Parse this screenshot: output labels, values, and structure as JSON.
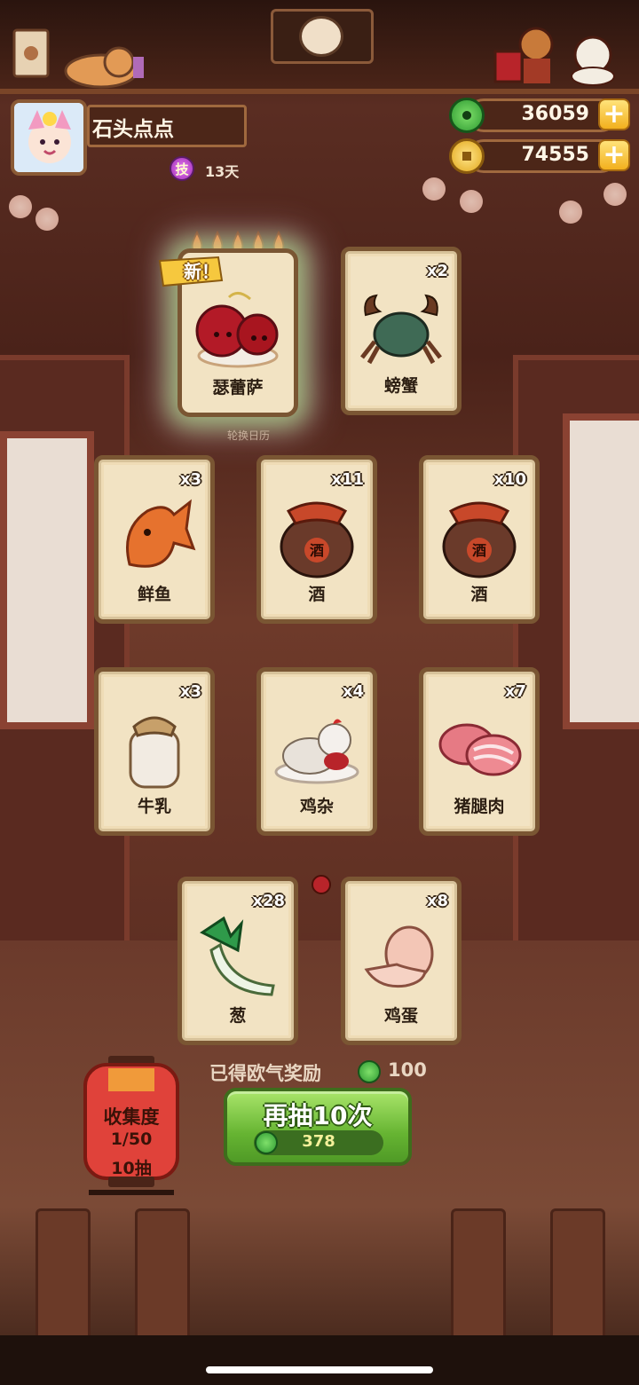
{
  "player": {
    "name": "石头点点",
    "skill_badge": "技",
    "skill_days": "13天"
  },
  "currency": {
    "jade": "36059",
    "coins": "74555"
  },
  "card_header": {
    "new_tag": "新！",
    "watermark": "轮换日历"
  },
  "cards": [
    {
      "name": "瑟蕾萨",
      "count": ""
    },
    {
      "name": "螃蟹",
      "count": "x2"
    },
    {
      "name": "鲜鱼",
      "count": "x3"
    },
    {
      "name": "酒",
      "count": "x11"
    },
    {
      "name": "酒",
      "count": "x10"
    },
    {
      "name": "牛乳",
      "count": "x3"
    },
    {
      "name": "鸡杂",
      "count": "x4"
    },
    {
      "name": "猪腿肉",
      "count": "x7"
    },
    {
      "name": "葱",
      "count": "x28"
    },
    {
      "name": "鸡蛋",
      "count": "x8"
    }
  ],
  "jar_label": "酒",
  "collection": {
    "title": "收集度",
    "progress": "1/50",
    "draws": "10抽"
  },
  "reward": {
    "label": "已得欧气奖励",
    "amount": "100"
  },
  "draw_button": {
    "label": "再抽10次",
    "cost": "378"
  },
  "colors": {
    "card_bg": "#f2e3c3",
    "card_border": "#7a5633",
    "button_green": "#66b432",
    "currency_box": "#4c2618"
  }
}
